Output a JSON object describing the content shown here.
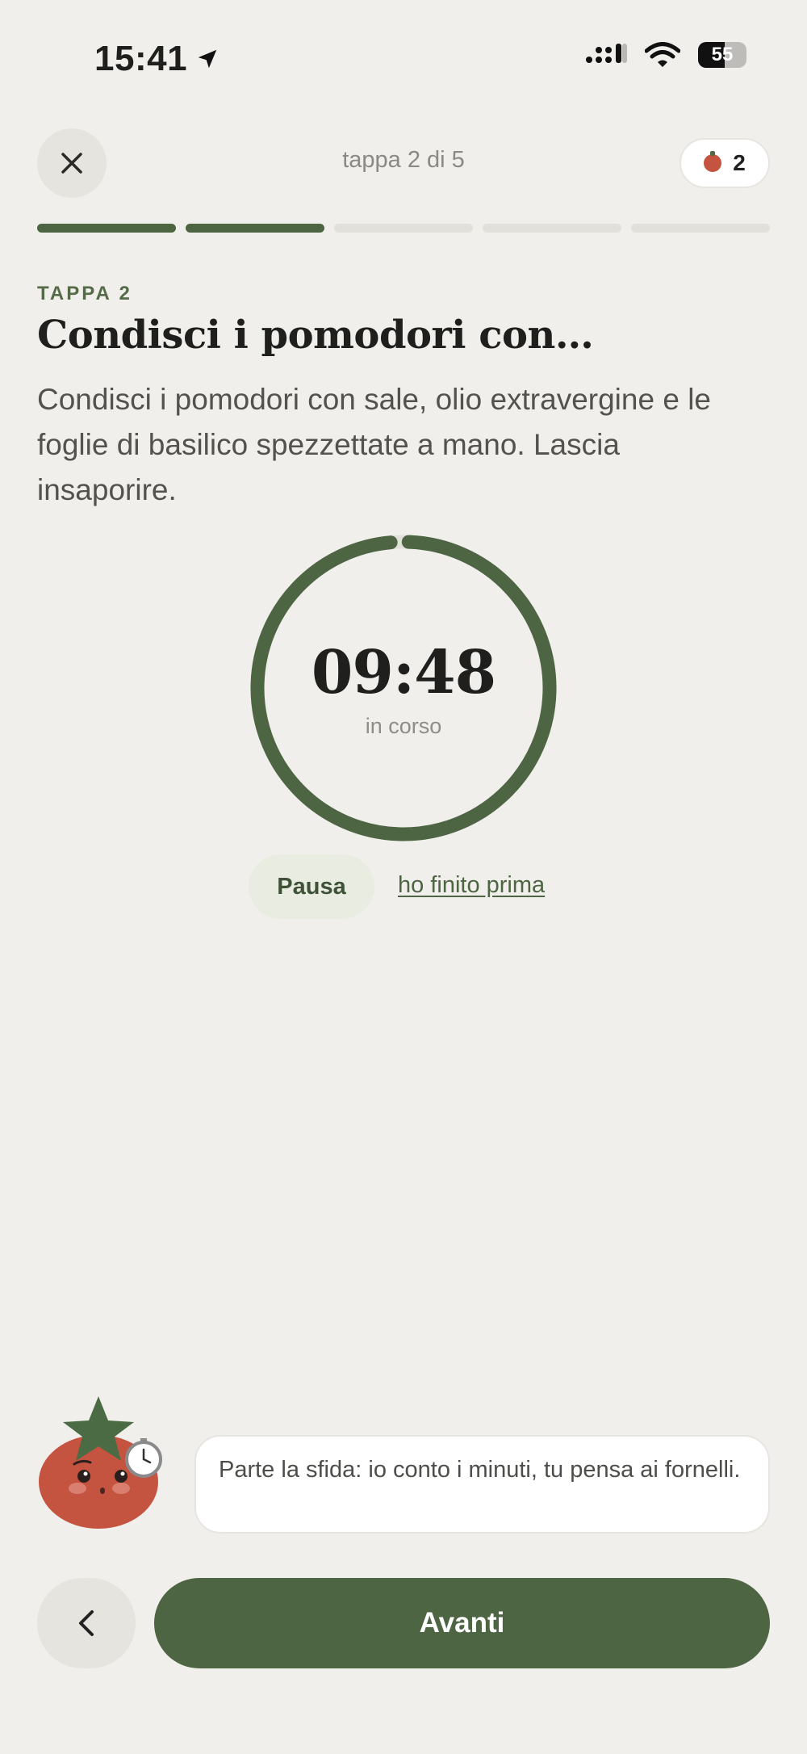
{
  "status_bar": {
    "time": "15:41",
    "battery": "55"
  },
  "header": {
    "step_label": "tappa 2 di 5",
    "tomato_count": "2",
    "progress": {
      "total": 5,
      "completed": 2
    }
  },
  "step": {
    "eyebrow": "TAPPA 2",
    "title": "Condisci i pomodori con…",
    "description": "Condisci i pomodori con sale, olio extravergine e le foglie di basilico spezzettate a mano. Lascia insaporire."
  },
  "timer": {
    "time": "09:48",
    "status": "in corso",
    "progress_fraction": 0.98,
    "color": "#4d6543"
  },
  "actions": {
    "pause_label": "Pausa",
    "finish_early_label": "ho finito prima"
  },
  "mascot": {
    "message": "Parte la sfida: io conto i minuti, tu pensa ai fornelli."
  },
  "nav": {
    "back_icon": "chevron-left-icon",
    "next_label": "Avanti"
  },
  "colors": {
    "accent": "#4d6543",
    "background": "#f0efeb",
    "tomato": "#c4533f"
  }
}
